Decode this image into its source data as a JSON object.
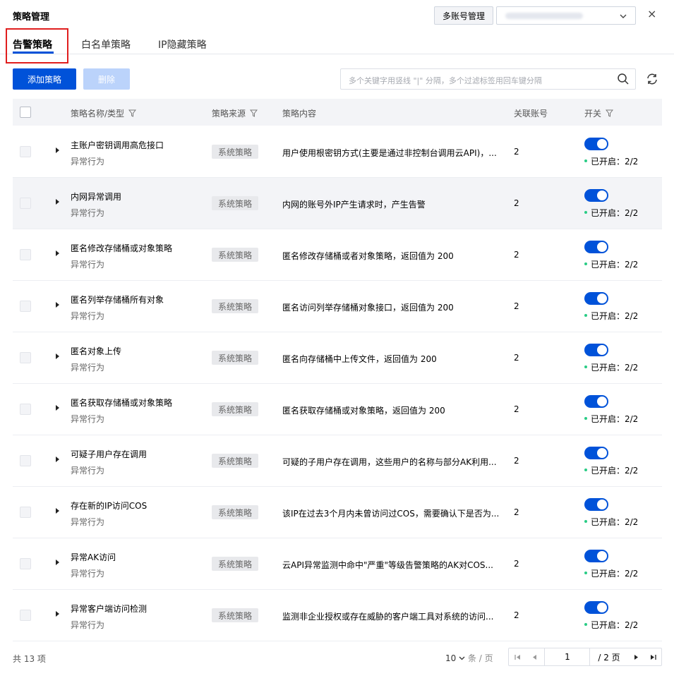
{
  "header": {
    "title": "策略管理",
    "account_button": "多账号管理",
    "account_selected": "",
    "close_label": "×"
  },
  "tabs": [
    {
      "label": "告警策略",
      "active": true
    },
    {
      "label": "白名单策略",
      "active": false
    },
    {
      "label": "IP隐藏策略",
      "active": false
    }
  ],
  "toolbar": {
    "add_label": "添加策略",
    "delete_label": "删除",
    "search_placeholder": "多个关键字用竖线 \"|\" 分隔，多个过滤标签用回车键分隔"
  },
  "table": {
    "columns": [
      "策略名称/类型",
      "策略来源",
      "策略内容",
      "关联账号",
      "开关"
    ],
    "rows": [
      {
        "name": "主账户密钥调用高危接口",
        "type": "异常行为",
        "source": "系统策略",
        "content": "用户使用根密钥方式(主要是通过非控制台调用云API)，...",
        "linked": "2",
        "status": "已开启：2/2"
      },
      {
        "name": "内网异常调用",
        "type": "异常行为",
        "source": "系统策略",
        "content": "内网的账号外IP产生请求时，产生告警",
        "linked": "2",
        "status": "已开启：2/2"
      },
      {
        "name": "匿名修改存储桶或对象策略",
        "type": "异常行为",
        "source": "系统策略",
        "content": "匿名修改存储桶或者对象策略，返回值为 200",
        "linked": "2",
        "status": "已开启：2/2"
      },
      {
        "name": "匿名列举存储桶所有对象",
        "type": "异常行为",
        "source": "系统策略",
        "content": "匿名访问列举存储桶对象接口，返回值为 200",
        "linked": "2",
        "status": "已开启：2/2"
      },
      {
        "name": "匿名对象上传",
        "type": "异常行为",
        "source": "系统策略",
        "content": "匿名向存储桶中上传文件，返回值为 200",
        "linked": "2",
        "status": "已开启：2/2"
      },
      {
        "name": "匿名获取存储桶或对象策略",
        "type": "异常行为",
        "source": "系统策略",
        "content": "匿名获取存储桶或对象策略，返回值为 200",
        "linked": "2",
        "status": "已开启：2/2"
      },
      {
        "name": "可疑子用户存在调用",
        "type": "异常行为",
        "source": "系统策略",
        "content": "可疑的子用户存在调用，这些用户的名称与部分AK利用...",
        "linked": "2",
        "status": "已开启：2/2"
      },
      {
        "name": "存在新的IP访问COS",
        "type": "异常行为",
        "source": "系统策略",
        "content": "该IP在过去3个月内未曾访问过COS，需要确认下是否为...",
        "linked": "2",
        "status": "已开启：2/2"
      },
      {
        "name": "异常AK访问",
        "type": "异常行为",
        "source": "系统策略",
        "content": "云API异常监测中命中\"严重\"等级告警策略的AK对COS...",
        "linked": "2",
        "status": "已开启：2/2"
      },
      {
        "name": "异常客户端访问检测",
        "type": "异常行为",
        "source": "系统策略",
        "content": "监测非企业授权或存在威胁的客户端工具对系统的访问...",
        "linked": "2",
        "status": "已开启：2/2"
      }
    ]
  },
  "footer": {
    "total": "共 13 项",
    "page_size": "10",
    "page_size_unit": "条 / 页",
    "current_page": "1",
    "total_pages": "/ 2 页"
  },
  "colors": {
    "primary": "#0052d9",
    "highlight": "#e01e1e",
    "success": "#29cc85"
  }
}
